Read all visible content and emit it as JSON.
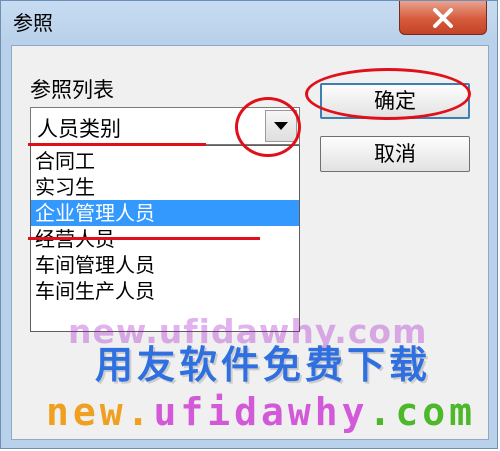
{
  "window": {
    "title": "参照"
  },
  "list": {
    "label": "参照列表",
    "selected_value": "人员类别",
    "options": [
      "合同工",
      "实习生",
      "企业管理人员",
      "经营人员",
      "车间管理人员",
      "车间生产人员"
    ],
    "highlighted_index": 2
  },
  "buttons": {
    "ok": "确定",
    "cancel": "取消"
  },
  "watermark": {
    "url_faint": "new.ufidawhy.com",
    "title": "用友软件免费下载",
    "footer_parts": [
      "new.",
      "ufidawhy",
      ".com"
    ],
    "footer_colors": [
      "#f0a020",
      "#d25ad8",
      "#4db82a"
    ]
  },
  "colors": {
    "highlight": "#3399ff",
    "annotation": "#e0101a",
    "title_watermark": "#2f6fe0"
  },
  "icons": [
    "close-icon",
    "dropdown-arrow-icon"
  ]
}
